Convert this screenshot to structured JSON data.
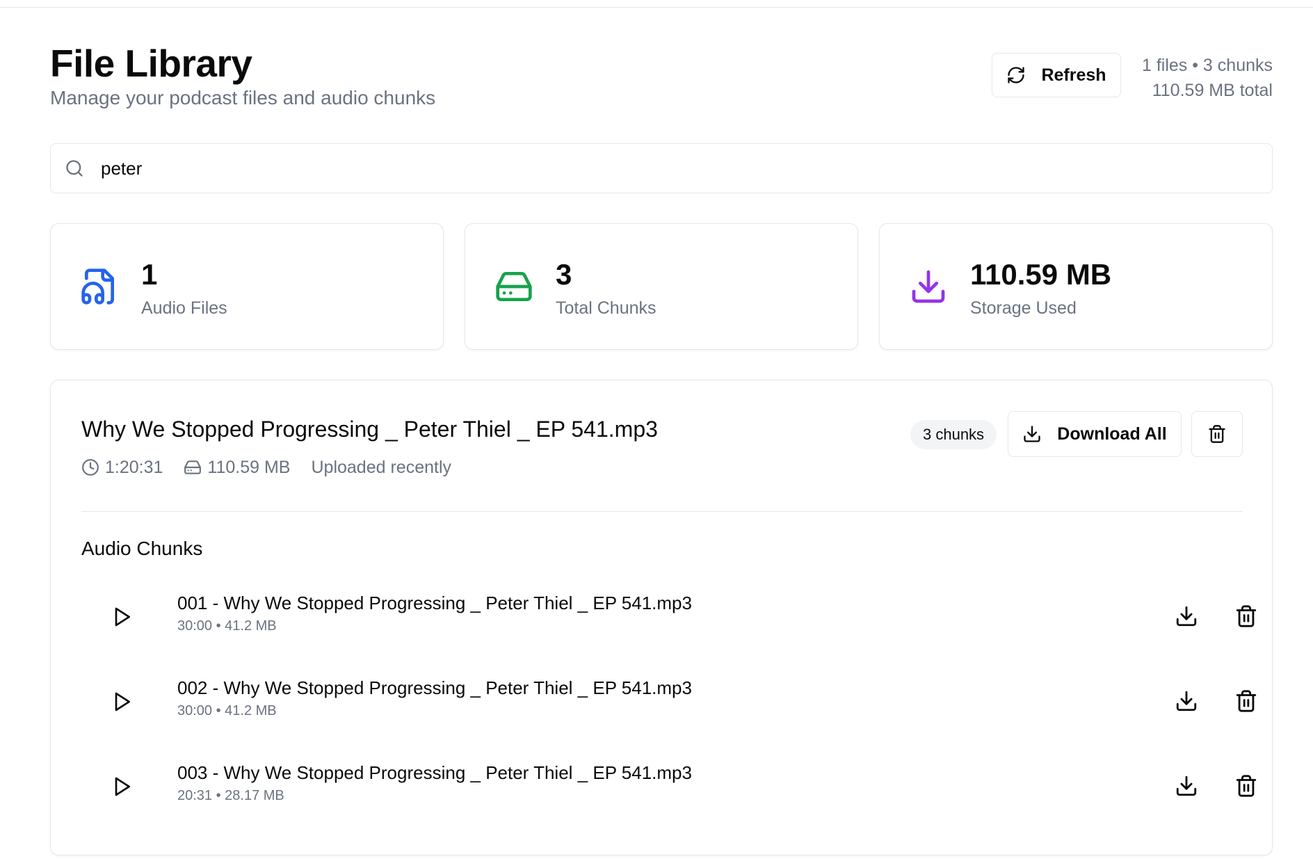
{
  "header": {
    "title": "File Library",
    "subtitle": "Manage your podcast files and audio chunks",
    "refresh_label": "Refresh",
    "summary_counts": "1 files • 3 chunks",
    "summary_size": "110.59 MB total"
  },
  "search": {
    "value": "peter",
    "icon": "search-icon"
  },
  "stats": [
    {
      "value": "1",
      "label": "Audio Files",
      "icon": "file-audio-icon",
      "color": "#2563eb"
    },
    {
      "value": "3",
      "label": "Total Chunks",
      "icon": "hard-drive-icon",
      "color": "#16a34a"
    },
    {
      "value": "110.59 MB",
      "label": "Storage Used",
      "icon": "download-icon",
      "color": "#9333ea"
    }
  ],
  "file": {
    "name": "Why We Stopped Progressing _ Peter Thiel _ EP 541.mp3",
    "duration": "1:20:31",
    "size": "110.59 MB",
    "uploaded": "Uploaded recently",
    "chunks_badge": "3 chunks",
    "download_all_label": "Download All",
    "chunks_title": "Audio Chunks",
    "chunks": [
      {
        "name": "001 - Why We Stopped Progressing _ Peter Thiel _ EP 541.mp3",
        "meta": "30:00 • 41.2 MB"
      },
      {
        "name": "002 - Why We Stopped Progressing _ Peter Thiel _ EP 541.mp3",
        "meta": "30:00 • 41.2 MB"
      },
      {
        "name": "003 - Why We Stopped Progressing _ Peter Thiel _ EP 541.mp3",
        "meta": "20:31 • 28.17 MB"
      }
    ]
  }
}
